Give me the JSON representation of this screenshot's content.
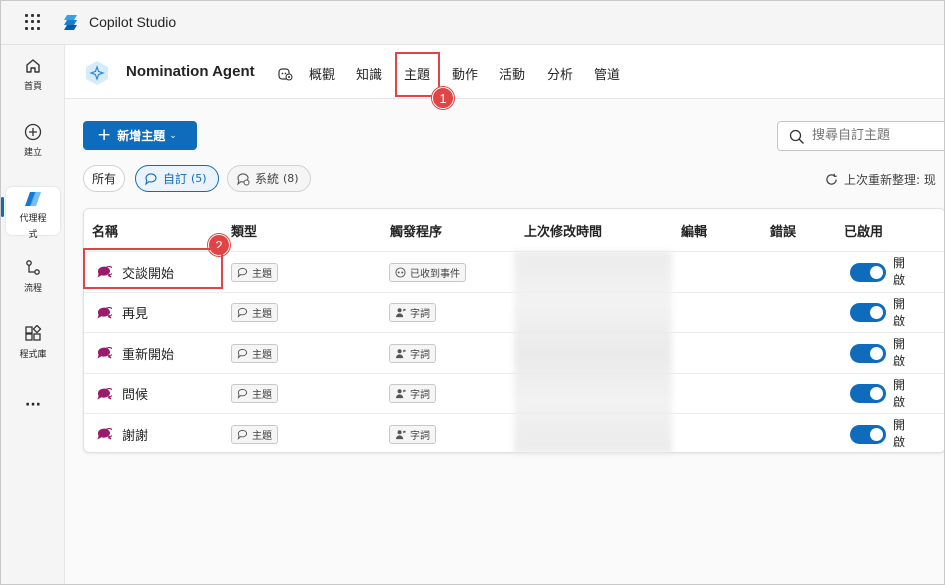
{
  "app": {
    "title": "Copilot Studio"
  },
  "leftnav": {
    "items": [
      {
        "label": "首頁",
        "icon": "home-icon"
      },
      {
        "label": "建立",
        "icon": "add-circle-icon"
      },
      {
        "label": "代理程式",
        "label_line1": "代理程",
        "label_line2": "式",
        "icon": "agents-icon",
        "active": true
      },
      {
        "label": "流程",
        "icon": "flow-icon"
      },
      {
        "label": "程式庫",
        "icon": "library-icon"
      }
    ],
    "more": "···"
  },
  "header": {
    "agent_name": "Nomination Agent",
    "tabs": [
      "概觀",
      "知識",
      "主題",
      "動作",
      "活動",
      "分析",
      "管道"
    ],
    "active_tab": "主題",
    "markers": [
      "1",
      "2"
    ]
  },
  "toolbar": {
    "new_topic_label": "新增主題",
    "search_placeholder": "搜尋自訂主題"
  },
  "filters": {
    "all_label": "所有",
    "custom_label": "自訂",
    "custom_count": "(5)",
    "system_label": "系統",
    "system_count": "(8)",
    "refresh_text": "上次重新整理: 现"
  },
  "table": {
    "headers": [
      "名稱",
      "類型",
      "觸發程序",
      "上次修改時間",
      "編輯",
      "錯誤",
      "已啟用"
    ],
    "rows": [
      {
        "name": "交談開始",
        "type": "主題",
        "trigger": "已收到事件",
        "enabled_l1": "開",
        "enabled_l2": "啟"
      },
      {
        "name": "再見",
        "type": "主題",
        "trigger": "字詞",
        "enabled_l1": "開",
        "enabled_l2": "啟"
      },
      {
        "name": "重新開始",
        "type": "主題",
        "trigger": "字詞",
        "enabled_l1": "開",
        "enabled_l2": "啟"
      },
      {
        "name": "問候",
        "type": "主題",
        "trigger": "字詞",
        "enabled_l1": "開",
        "enabled_l2": "啟"
      },
      {
        "name": "謝謝",
        "type": "主題",
        "trigger": "字詞",
        "enabled_l1": "開",
        "enabled_l2": "啟"
      }
    ]
  },
  "colors": {
    "accent": "#0f6cbd",
    "highlight": "#e04444",
    "topic_icon": "#9b1b6b"
  }
}
